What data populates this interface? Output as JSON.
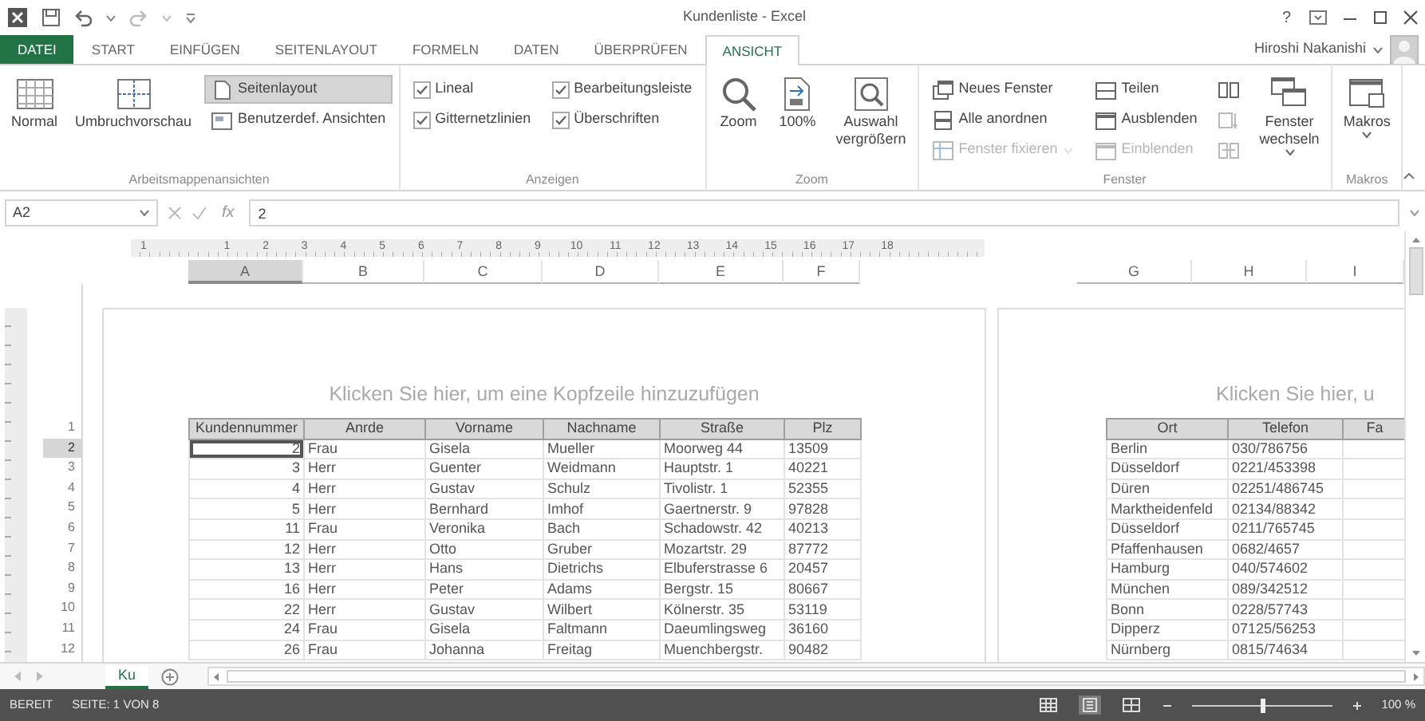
{
  "title_bar": {
    "title": "Kundenliste - Excel",
    "help": "?"
  },
  "tabs": [
    {
      "label": "DATEI",
      "kind": "file",
      "selected": false
    },
    {
      "label": "START",
      "kind": "tab",
      "selected": false
    },
    {
      "label": "EINFÜGEN",
      "kind": "tab",
      "selected": false
    },
    {
      "label": "SEITENLAYOUT",
      "kind": "tab",
      "selected": false
    },
    {
      "label": "FORMELN",
      "kind": "tab",
      "selected": false
    },
    {
      "label": "DATEN",
      "kind": "tab",
      "selected": false
    },
    {
      "label": "ÜBERPRÜFEN",
      "kind": "tab",
      "selected": false
    },
    {
      "label": "ANSICHT",
      "kind": "tab",
      "selected": true
    }
  ],
  "user": {
    "name": "Hiroshi Nakanishi"
  },
  "ribbon": [
    {
      "label": "Arbeitsmappenansichten",
      "columns": [
        [
          {
            "kind": "large",
            "label": "Normal",
            "selected": false
          }
        ],
        [
          {
            "kind": "large",
            "label": "Umbruchvorschau",
            "selected": false
          }
        ],
        [
          {
            "kind": "small",
            "label": "Seitenlayout",
            "selected": true
          },
          {
            "kind": "small",
            "label": "Benutzerdef. Ansichten",
            "selected": false
          }
        ]
      ]
    },
    {
      "label": "Anzeigen",
      "columns": [
        [
          {
            "kind": "check",
            "label": "Lineal",
            "checked": true
          },
          {
            "kind": "check",
            "label": "Gitternetzlinien",
            "checked": true
          }
        ],
        [
          {
            "kind": "check",
            "label": "Bearbeitungsleiste",
            "checked": true
          },
          {
            "kind": "check",
            "label": "Überschriften",
            "checked": true
          }
        ]
      ]
    },
    {
      "label": "Zoom",
      "columns": [
        [
          {
            "kind": "large",
            "label": "Zoom"
          }
        ],
        [
          {
            "kind": "large",
            "label": "100%"
          }
        ],
        [
          {
            "kind": "large",
            "label": "Auswahl vergrößern"
          }
        ]
      ]
    },
    {
      "label": "Fenster",
      "columns": [
        [
          {
            "kind": "small",
            "label": "Neues Fenster",
            "disabled": false
          },
          {
            "kind": "small",
            "label": "Alle anordnen",
            "disabled": false
          },
          {
            "kind": "small",
            "label": "Fenster fixieren",
            "disabled": true,
            "dropdown": true
          }
        ],
        [
          {
            "kind": "small",
            "label": "Teilen",
            "disabled": false
          },
          {
            "kind": "small",
            "label": "Ausblenden",
            "disabled": false
          },
          {
            "kind": "small",
            "label": "Einblenden",
            "disabled": true
          }
        ],
        [
          {
            "kind": "icon",
            "disabled": false
          },
          {
            "kind": "icon",
            "disabled": true
          },
          {
            "kind": "icon",
            "disabled": true
          }
        ],
        [
          {
            "kind": "large",
            "label": "Fenster wechseln",
            "dropdown": true
          }
        ]
      ]
    },
    {
      "label": "Makros",
      "columns": [
        [
          {
            "kind": "large",
            "label": "Makros",
            "dropdown": true
          }
        ]
      ]
    }
  ],
  "formula_bar": {
    "name_box": "A2",
    "function_label": "fx",
    "value": "2"
  },
  "ruler": [
    "1",
    "1",
    "2",
    "3",
    "4",
    "5",
    "6",
    "7",
    "8",
    "9",
    "10",
    "11",
    "12",
    "13",
    "14",
    "15",
    "16",
    "17",
    "18"
  ],
  "row_headers": [
    {
      "label": "1",
      "selected": false
    },
    {
      "label": "2",
      "selected": true
    },
    {
      "label": "3",
      "selected": false
    },
    {
      "label": "4",
      "selected": false
    },
    {
      "label": "5",
      "selected": false
    },
    {
      "label": "6",
      "selected": false
    },
    {
      "label": "7",
      "selected": false
    },
    {
      "label": "8",
      "selected": false
    },
    {
      "label": "9",
      "selected": false
    },
    {
      "label": "10",
      "selected": false
    },
    {
      "label": "11",
      "selected": false
    },
    {
      "label": "12",
      "selected": false
    }
  ],
  "pages": [
    {
      "column_headers": [
        {
          "label": "A",
          "selected": true
        },
        {
          "label": "B",
          "selected": false
        },
        {
          "label": "C",
          "selected": false
        },
        {
          "label": "D",
          "selected": false
        },
        {
          "label": "E",
          "selected": false
        },
        {
          "label": "F",
          "selected": false
        }
      ],
      "header_prompt": "Klicken Sie hier, um eine Kopfzeile hinzuzufügen",
      "table": {
        "columns": [
          {
            "label": "Kundennummer",
            "kind": "number"
          },
          {
            "label": "Anrde",
            "kind": "text"
          },
          {
            "label": "Vorname",
            "kind": "text"
          },
          {
            "label": "Nachname",
            "kind": "text"
          },
          {
            "label": "Straße",
            "kind": "text"
          },
          {
            "label": "Plz",
            "kind": "text"
          }
        ],
        "rows": [
          {
            "cells": [
              "2",
              "Frau",
              "Gisela",
              "Mueller",
              "Moorweg 44",
              "13509"
            ]
          },
          {
            "cells": [
              "3",
              "Herr",
              "Guenter",
              "Weidmann",
              "Hauptstr. 1",
              "40221"
            ]
          },
          {
            "cells": [
              "4",
              "Herr",
              "Gustav",
              "Schulz",
              "Tivolistr. 1",
              "52355"
            ]
          },
          {
            "cells": [
              "5",
              "Herr",
              "Bernhard",
              "Imhof",
              "Gaertnerstr. 9",
              "97828"
            ]
          },
          {
            "cells": [
              "11",
              "Frau",
              "Veronika",
              "Bach",
              "Schadowstr. 42",
              "40213"
            ]
          },
          {
            "cells": [
              "12",
              "Herr",
              "Otto",
              "Gruber",
              "Mozartstr. 29",
              "87772"
            ]
          },
          {
            "cells": [
              "13",
              "Herr",
              "Hans",
              "Dietrichs",
              "Elbuferstrasse 6",
              "20457"
            ]
          },
          {
            "cells": [
              "16",
              "Herr",
              "Peter",
              "Adams",
              "Bergstr. 15",
              "80667"
            ]
          },
          {
            "cells": [
              "22",
              "Herr",
              "Gustav",
              "Wilbert",
              "Kölnerstr. 35",
              "53119"
            ]
          },
          {
            "cells": [
              "24",
              "Frau",
              "Gisela",
              "Faltmann",
              "Daeumlingsweg",
              "36160"
            ]
          },
          {
            "cells": [
              "26",
              "Frau",
              "Johanna",
              "Freitag",
              "Muenchbergstr.",
              "90482"
            ]
          }
        ]
      }
    },
    {
      "column_headers": [
        {
          "label": "G",
          "selected": false
        },
        {
          "label": "H",
          "selected": false
        },
        {
          "label": "I",
          "selected": false
        }
      ],
      "header_prompt": "Klicken Sie hier, u",
      "table": {
        "columns": [
          {
            "label": "Ort",
            "kind": "text"
          },
          {
            "label": "Telefon",
            "kind": "text"
          },
          {
            "label": "Fa",
            "kind": "text"
          }
        ],
        "rows": [
          {
            "cells": [
              "Berlin",
              "030/786756"
            ]
          },
          {
            "cells": [
              "Düsseldorf",
              "0221/453398"
            ]
          },
          {
            "cells": [
              "Düren",
              "02251/486745"
            ]
          },
          {
            "cells": [
              "Marktheidenfeld",
              "02134/88342"
            ]
          },
          {
            "cells": [
              "Düsseldorf",
              "0211/765745"
            ]
          },
          {
            "cells": [
              "Pfaffenhausen",
              "0682/4657"
            ]
          },
          {
            "cells": [
              "Hamburg",
              "040/574602"
            ]
          },
          {
            "cells": [
              "München",
              "089/342512"
            ]
          },
          {
            "cells": [
              "Bonn",
              "0228/57743"
            ]
          },
          {
            "cells": [
              "Dipperz",
              "07125/56253"
            ]
          },
          {
            "cells": [
              "Nürnberg",
              "0815/74634"
            ]
          }
        ]
      }
    }
  ],
  "sheet_tabs": [
    {
      "label": "Ku",
      "selected": true
    }
  ],
  "status_bar": {
    "mode": "BEREIT",
    "page": "SEITE: 1 VON 8",
    "views": [
      {
        "selected": false
      },
      {
        "selected": true
      },
      {
        "selected": false
      }
    ],
    "zoom_slider": {
      "level": 0.5
    },
    "zoom": "100 %"
  }
}
